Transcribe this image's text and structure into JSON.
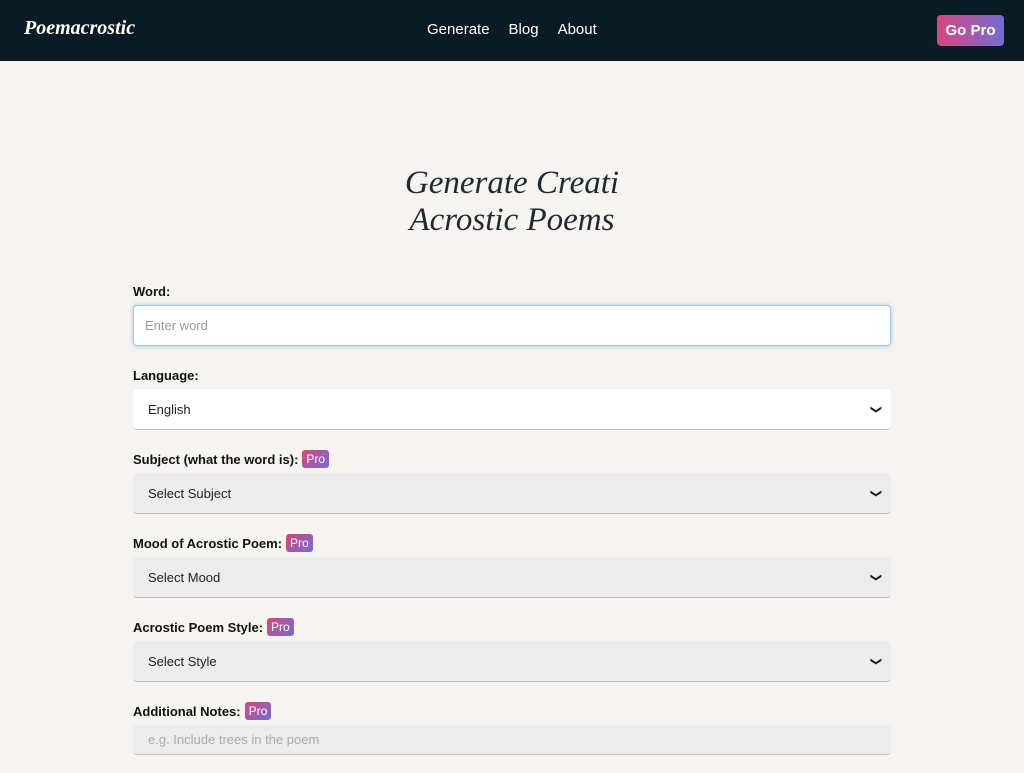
{
  "navbar": {
    "brand": "Poemacrostic",
    "links": [
      "Generate",
      "Blog",
      "About"
    ],
    "go_pro": "Go Pro"
  },
  "hero": {
    "line1": "Generate Creati",
    "line2": "Acrostic Poems"
  },
  "form": {
    "word": {
      "label": "Word:",
      "placeholder": "Enter word"
    },
    "language": {
      "label": "Language:",
      "value": "English"
    },
    "subject": {
      "label": "Subject (what the word is):",
      "badge": "Pro",
      "value": "Select Subject"
    },
    "mood": {
      "label": "Mood of Acrostic Poem:",
      "badge": "Pro",
      "value": "Select Mood"
    },
    "style": {
      "label": "Acrostic Poem Style:",
      "badge": "Pro",
      "value": "Select Style"
    },
    "notes": {
      "label": "Additional Notes:",
      "badge": "Pro",
      "placeholder": "e.g. Include trees in the poem"
    }
  },
  "colors": {
    "navbar": "#0b1b26",
    "background": "#f5f4f0",
    "pro_gradient_start": "#d9457f",
    "pro_gradient_end": "#6f6fd0"
  }
}
